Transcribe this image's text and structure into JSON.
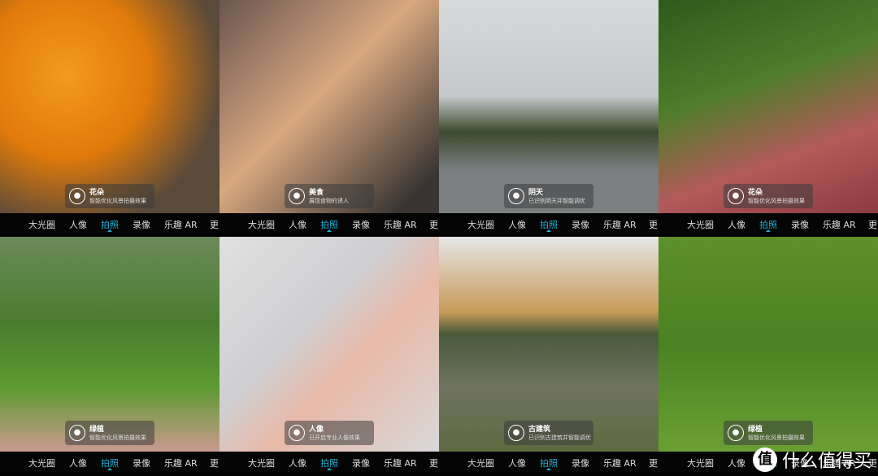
{
  "mode_bar": {
    "modes": [
      "大光圈",
      "人像",
      "拍照",
      "录像",
      "乐趣 AR",
      "更"
    ],
    "active": "拍照",
    "active_color": "#1db3d6"
  },
  "panels": [
    {
      "scene": "花朵",
      "desc": "智能优化风景拍摄效果",
      "icon": "flower-icon"
    },
    {
      "scene": "美食",
      "desc": "展现食物的诱人",
      "icon": "food-icon"
    },
    {
      "scene": "阴天",
      "desc": "已识别阴天并智能调优",
      "icon": "cloud-icon"
    },
    {
      "scene": "花朵",
      "desc": "智能优化风景拍摄效果",
      "icon": "flower-icon"
    },
    {
      "scene": "绿植",
      "desc": "智能优化风景拍摄效果",
      "icon": "leaf-icon"
    },
    {
      "scene": "人像",
      "desc": "已开启专业人像效果",
      "icon": "person-icon"
    },
    {
      "scene": "古建筑",
      "desc": "已识别古建筑并智能调优",
      "icon": "building-icon"
    },
    {
      "scene": "绿植",
      "desc": "智能优化风景拍摄效果",
      "icon": "leaf-icon"
    }
  ],
  "watermark": {
    "text": "什么值得买",
    "mark": "值"
  }
}
